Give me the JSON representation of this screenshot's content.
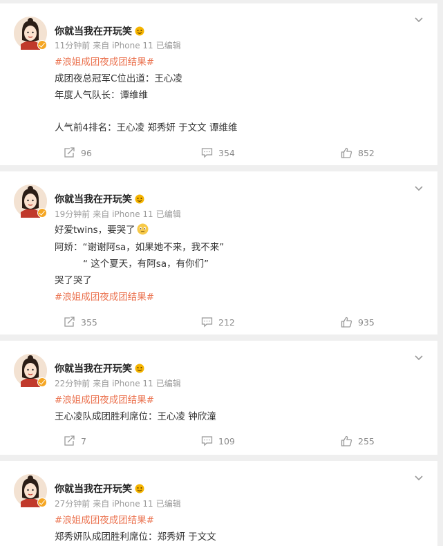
{
  "posts": [
    {
      "username": "你就当我在开玩笑",
      "time": "11分钟前",
      "source": "来自 iPhone 11",
      "edited": "已编辑",
      "lines": [
        {
          "text": "#浪姐成团夜成团结果#",
          "type": "tag"
        },
        {
          "text": "成团夜总冠军C位出道：王心凌",
          "type": "text"
        },
        {
          "text": "年度人气队长：谭维维",
          "type": "text"
        },
        {
          "text": "人气前4排名：王心凌 郑秀妍 于文文 谭维维",
          "type": "text"
        }
      ],
      "reposts": "96",
      "comments": "354",
      "likes": "852"
    },
    {
      "username": "你就当我在开玩笑",
      "time": "19分钟前",
      "source": "来自 iPhone 11",
      "edited": "已编辑",
      "lines": [
        {
          "text": "好爱twins，要哭了",
          "type": "text"
        },
        {
          "text": "阿娇：“谢谢阿sa，如果她不来，我不来”",
          "type": "text"
        },
        {
          "text": "“ 这个夏天，有阿sa，有你们”",
          "type": "text"
        },
        {
          "text": "哭了哭了",
          "type": "text"
        },
        {
          "text": "#浪姐成团夜成团结果#",
          "type": "tag"
        }
      ],
      "reposts": "355",
      "comments": "212",
      "likes": "935"
    },
    {
      "username": "你就当我在开玩笑",
      "time": "22分钟前",
      "source": "来自 iPhone 11",
      "edited": "已编辑",
      "lines": [
        {
          "text": "#浪姐成团夜成团结果#",
          "type": "tag"
        },
        {
          "text": "王心凌队成团胜利席位：王心凌 钟欣潼",
          "type": "text"
        }
      ],
      "reposts": "7",
      "comments": "109",
      "likes": "255"
    },
    {
      "username": "你就当我在开玩笑",
      "time": "27分钟前",
      "source": "来自 iPhone 11",
      "edited": "已编辑",
      "lines": [
        {
          "text": "#浪姐成团夜成团结果#",
          "type": "tag"
        },
        {
          "text": "郑秀妍队成团胜利席位：郑秀妍 于文文",
          "type": "text"
        }
      ]
    }
  ],
  "colors": {
    "tag": "#eb7350",
    "background": "#efefef",
    "card": "#ffffff",
    "meta": "#9a9a9a"
  },
  "icons": {
    "repost": "repost-icon",
    "comment": "comment-icon",
    "like": "like-icon",
    "chevron": "chevron-down-icon",
    "verified": "verified-badge-icon"
  }
}
